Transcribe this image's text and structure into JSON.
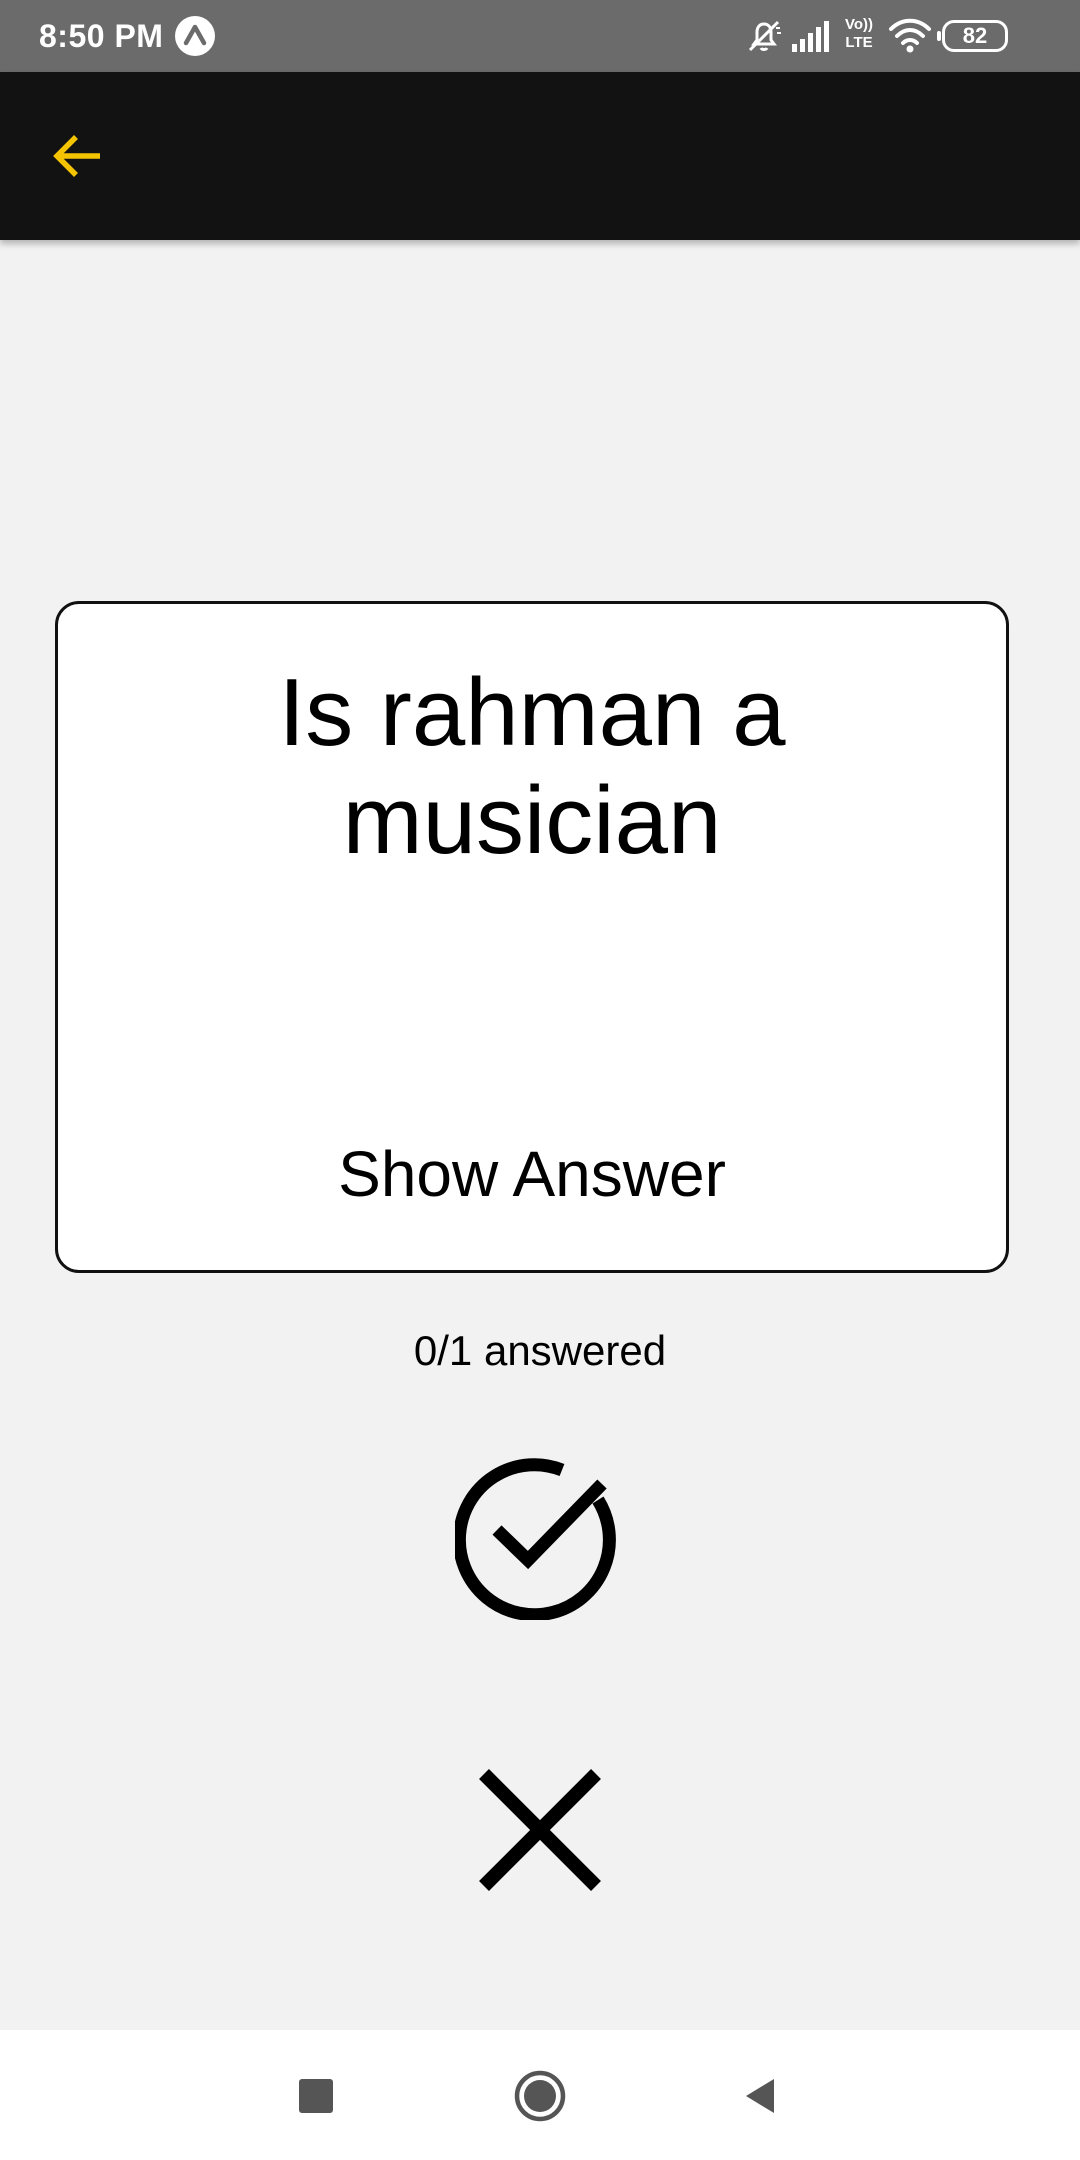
{
  "status_bar": {
    "time": "8:50 PM",
    "battery": "82",
    "network_label_top": "Vo))",
    "network_label_bottom": "LTE",
    "icons": [
      "app-notification-icon",
      "mute-icon",
      "signal-icon",
      "volte-icon",
      "wifi-icon",
      "battery-icon"
    ]
  },
  "toolbar": {
    "back_icon": "arrow-left-icon",
    "accent_color": "#f5c400",
    "background": "#121212"
  },
  "card": {
    "question": "Is rahman a musician",
    "show_answer_label": "Show Answer"
  },
  "progress": {
    "answered": 0,
    "total": 1,
    "text": "0/1 answered"
  },
  "actions": {
    "correct_icon": "check-circle-icon",
    "wrong_icon": "close-icon"
  },
  "nav_bar": {
    "items": [
      "recents-square-icon",
      "home-circle-icon",
      "back-triangle-icon"
    ]
  },
  "colors": {
    "background": "#f2f2f2",
    "status_bar": "#6b6b6b",
    "card": "#ffffff"
  }
}
